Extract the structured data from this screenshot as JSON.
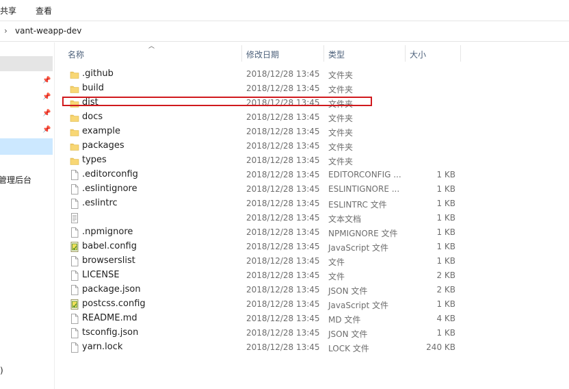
{
  "menubar": {
    "items": [
      "共享",
      "查看"
    ]
  },
  "address": {
    "path": "vant-weapp-dev"
  },
  "nav": {
    "visible_text": "管理后台",
    "bottom_fragment": ")"
  },
  "columns": {
    "name": "名称",
    "date": "修改日期",
    "type": "类型",
    "size": "大小"
  },
  "files": [
    {
      "name": ".github",
      "date": "2018/12/28 13:45",
      "type": "文件夹",
      "size": "",
      "icon": "folder-icon"
    },
    {
      "name": "build",
      "date": "2018/12/28 13:45",
      "type": "文件夹",
      "size": "",
      "icon": "folder-icon"
    },
    {
      "name": "dist",
      "date": "2018/12/28 13:45",
      "type": "文件夹",
      "size": "",
      "icon": "folder-icon"
    },
    {
      "name": "docs",
      "date": "2018/12/28 13:45",
      "type": "文件夹",
      "size": "",
      "icon": "folder-icon"
    },
    {
      "name": "example",
      "date": "2018/12/28 13:45",
      "type": "文件夹",
      "size": "",
      "icon": "folder-icon"
    },
    {
      "name": "packages",
      "date": "2018/12/28 13:45",
      "type": "文件夹",
      "size": "",
      "icon": "folder-icon"
    },
    {
      "name": "types",
      "date": "2018/12/28 13:45",
      "type": "文件夹",
      "size": "",
      "icon": "folder-icon"
    },
    {
      "name": ".editorconfig",
      "date": "2018/12/28 13:45",
      "type": "EDITORCONFIG ...",
      "size": "1 KB",
      "icon": "file-icon"
    },
    {
      "name": ".eslintignore",
      "date": "2018/12/28 13:45",
      "type": "ESLINTIGNORE ...",
      "size": "1 KB",
      "icon": "file-icon"
    },
    {
      "name": ".eslintrc",
      "date": "2018/12/28 13:45",
      "type": "ESLINTRC 文件",
      "size": "1 KB",
      "icon": "file-icon"
    },
    {
      "name": "",
      "date": "2018/12/28 13:45",
      "type": "文本文档",
      "size": "1 KB",
      "icon": "text-file-icon"
    },
    {
      "name": ".npmignore",
      "date": "2018/12/28 13:45",
      "type": "NPMIGNORE 文件",
      "size": "1 KB",
      "icon": "file-icon"
    },
    {
      "name": "babel.config",
      "date": "2018/12/28 13:45",
      "type": "JavaScript 文件",
      "size": "1 KB",
      "icon": "js-file-icon"
    },
    {
      "name": "browserslist",
      "date": "2018/12/28 13:45",
      "type": "文件",
      "size": "1 KB",
      "icon": "file-icon"
    },
    {
      "name": "LICENSE",
      "date": "2018/12/28 13:45",
      "type": "文件",
      "size": "2 KB",
      "icon": "file-icon"
    },
    {
      "name": "package.json",
      "date": "2018/12/28 13:45",
      "type": "JSON 文件",
      "size": "2 KB",
      "icon": "file-icon"
    },
    {
      "name": "postcss.config",
      "date": "2018/12/28 13:45",
      "type": "JavaScript 文件",
      "size": "1 KB",
      "icon": "js-file-icon"
    },
    {
      "name": "README.md",
      "date": "2018/12/28 13:45",
      "type": "MD 文件",
      "size": "4 KB",
      "icon": "file-icon"
    },
    {
      "name": "tsconfig.json",
      "date": "2018/12/28 13:45",
      "type": "JSON 文件",
      "size": "1 KB",
      "icon": "file-icon"
    },
    {
      "name": "yarn.lock",
      "date": "2018/12/28 13:45",
      "type": "LOCK 文件",
      "size": "240 KB",
      "icon": "file-icon"
    }
  ],
  "colors": {
    "highlight_box": "#d0191d",
    "folder": "#f8d775",
    "header_text": "#4c607a"
  }
}
